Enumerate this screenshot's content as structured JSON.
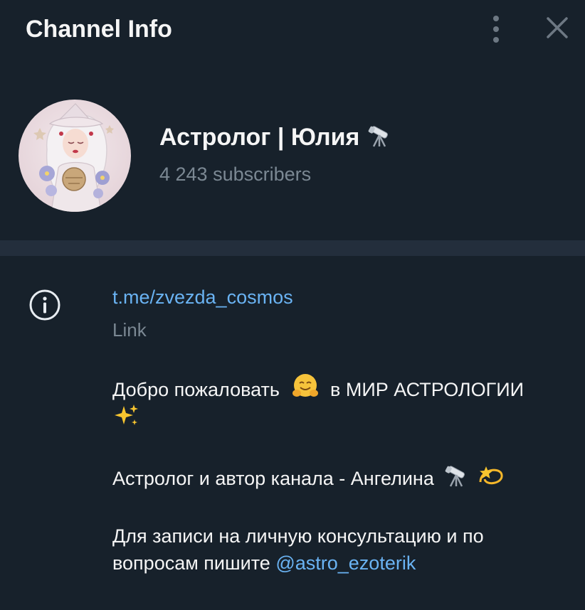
{
  "window": {
    "title": "Channel Info",
    "menu_icon": "more-vertical-icon",
    "close_icon": "close-icon"
  },
  "channel": {
    "name": "Астролог | Юлия",
    "name_emoji": "telescope",
    "subscribers": "4 243 subscribers",
    "avatar": "astrologer-illustration-avatar"
  },
  "info": {
    "icon": "info-icon",
    "link": "t.me/zvezda_cosmos",
    "link_label": "Link",
    "description": {
      "line1_prefix": "Добро пожаловать",
      "line1_emoji": "hugging-face",
      "line1_suffix": "в МИР АСТРОЛОГИИ",
      "line1_trailing_emoji": "sparkles",
      "line2_text": "Астролог и автор канала - Ангелина",
      "line2_emojis": [
        "telescope",
        "dizzy-star"
      ],
      "line3_text": "Для записи на личную консультацию и по вопросам пишите",
      "line3_mention": "@astro_ezoterik"
    }
  },
  "colors": {
    "background": "#17212b",
    "divider": "#232e3c",
    "link": "#6ab3f3",
    "secondary_text": "#7b8893"
  }
}
